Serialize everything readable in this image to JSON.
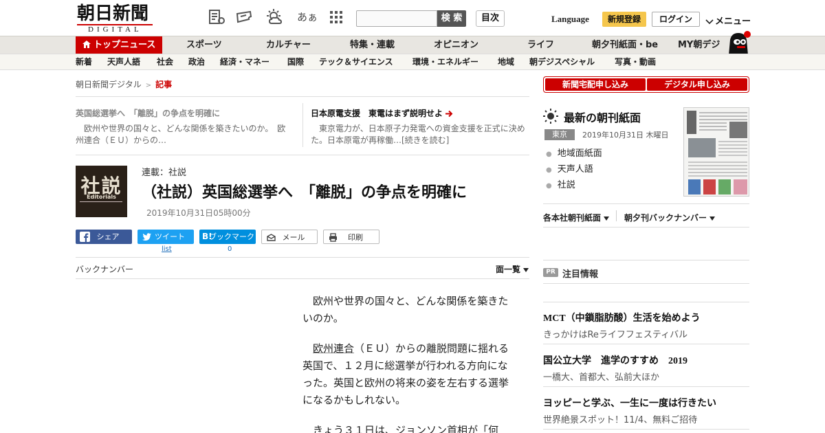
{
  "header": {
    "logo_kanji": "朝日新聞",
    "logo_sub": "DIGITAL",
    "search_button": "検 索",
    "search_placeholder": "",
    "toc_button": "目次",
    "language": "Language",
    "register": "新規登録",
    "login": "ログイン",
    "menu": "メニュー",
    "font_size_icon_text": "あぁ"
  },
  "nav_primary": [
    "トップニュース",
    "スポーツ",
    "カルチャー",
    "特集・連載",
    "オピニオン",
    "ライフ",
    "朝夕刊紙面・be",
    "MY朝デジ"
  ],
  "nav_secondary": [
    "新着",
    "天声人語",
    "社会",
    "政治",
    "経済・マネー",
    "国際",
    "テック＆サイエンス",
    "環境・エネルギー",
    "地域",
    "朝デジスペシャル",
    "写真・動画"
  ],
  "breadcrumb": {
    "home": "朝日新聞デジタル",
    "sep": ">",
    "current": "記事"
  },
  "related": [
    {
      "title": "英国総選挙へ　「離脱」の争点を明確に",
      "desc": "欧州や世界の国々と、どんな関係を築きたいのか。　欧州連合（ＥＵ）からの…"
    },
    {
      "title": "日本原電支援　東電はまず説明せよ",
      "desc": "東京電力が、日本原子力発電への資金支援を正式に決めた。日本原電が再稼働…[続きを読む]"
    }
  ],
  "article": {
    "thumb_big": "社説",
    "thumb_small": "Editorials",
    "series": "連載：社説",
    "headline": "（社説）英国総選挙へ　「離脱」の争点を明確に",
    "date": "2019年10月31日05時00分",
    "paragraphs": [
      "欧州や世界の国々と、どんな関係を築きたいのか。",
      "（ＥＵ）からの離脱問題に揺れる英国で、１２月に総選挙が行われる方向になった。英国と欧州の将来の姿を左右する選挙になるかもしれない。",
      "きょう３１日は、ジョンソン首相が「何"
    ],
    "para2_link": "欧州連合"
  },
  "social": {
    "share": "シェア",
    "tweet": "ツイート",
    "bookmark": "ブックマーク",
    "mail": "メール",
    "print": "印刷",
    "tweet_count": "list",
    "bookmark_count": "0"
  },
  "back_number": "バックナンバー",
  "ichiran": "面一覧",
  "sidebar": {
    "subscribe_paper": "新聞宅配申し込み",
    "subscribe_digital": "デジタル申し込み",
    "latest_title": "最新の朝刊紙面",
    "region": "東京",
    "paper_date": "2019年10月31日 木曜日",
    "links": [
      "地域面紙面",
      "天声人語",
      "社説"
    ],
    "dropdown1": "各本社朝刊紙面",
    "dropdown2": "朝夕刊バックナンバー",
    "pr_badge": "PR",
    "chumoku": "注目情報",
    "ads": [
      {
        "title": "MCT（中鎖脂肪酸）生活を始めよう",
        "sub": "きっかけはReライフフェスティバル"
      },
      {
        "title": "国公立大学　進学のすすめ　2019",
        "sub": "一橋大、首都大、弘前大ほか"
      },
      {
        "title": "ヨッピーと学ぶ、一生に一度は行きたい",
        "sub": "世界絶景スポット！11/4、無料ご招待"
      }
    ]
  },
  "colors": {
    "brand_red": "#cc0000",
    "facebook": "#3b5998",
    "twitter": "#1da1f2",
    "hatena": "#008fde",
    "register_yellow": "#f5c64c"
  }
}
